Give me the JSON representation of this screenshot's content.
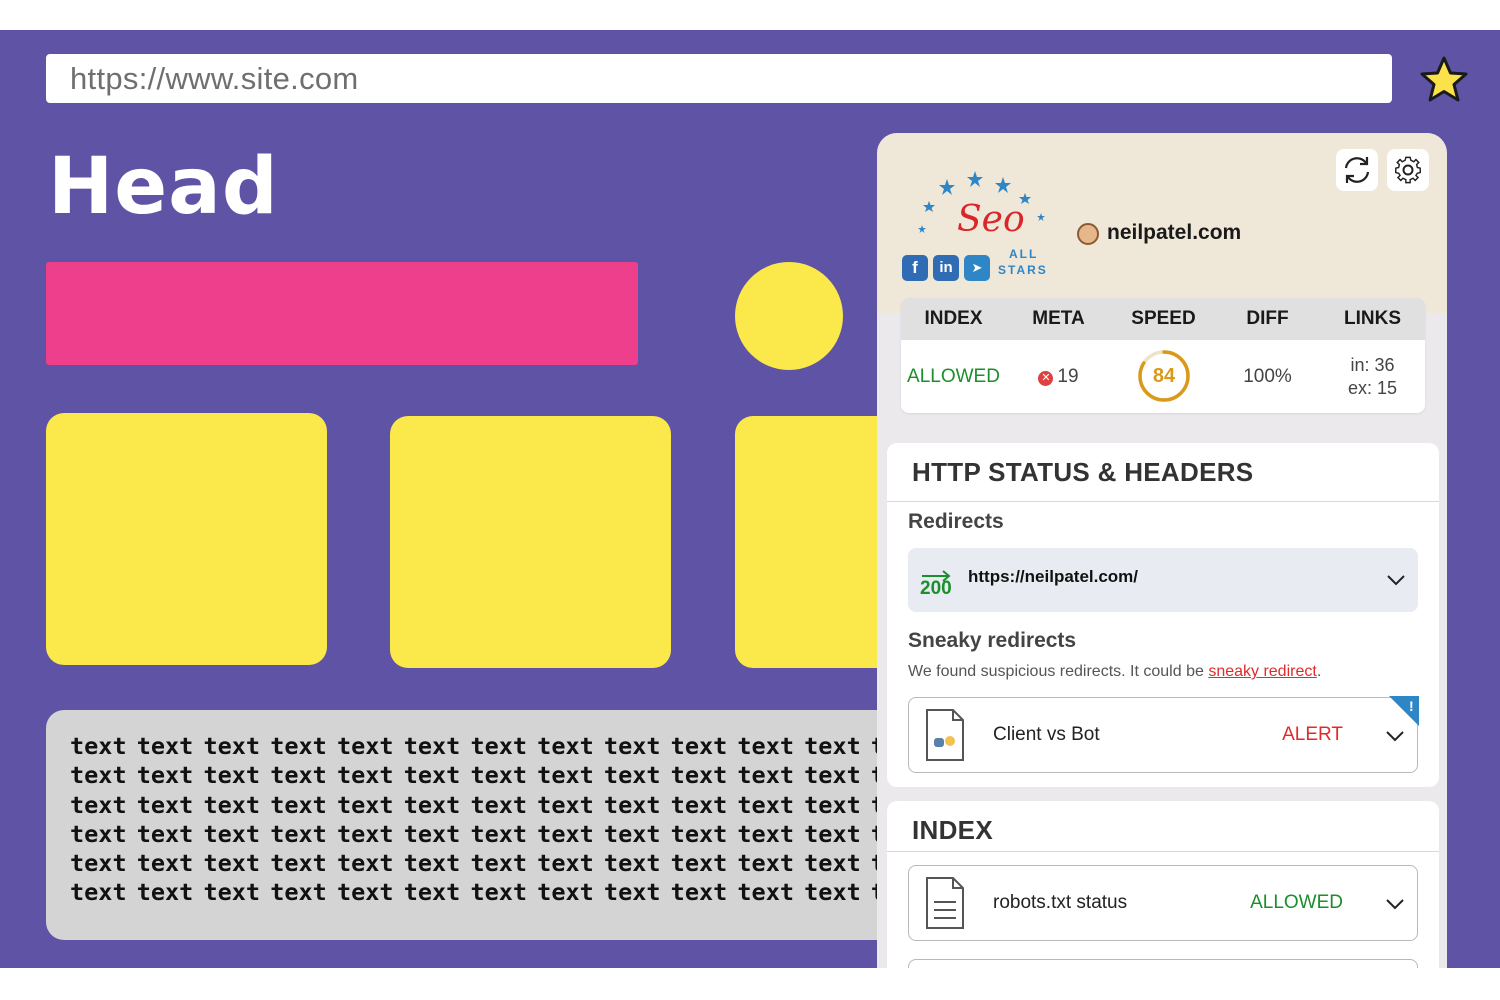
{
  "browser": {
    "url": "https://www.site.com",
    "bookmark_icon": "star-icon",
    "bookmark_color": "#fbe14a"
  },
  "page": {
    "head": "Head",
    "text_lines": [
      "text text text text text text text text text text text text text te",
      "text text text text text text text text text text text text text te",
      "text text text text text text text text text text text text text te",
      "text text text text text text text text text text text text text te",
      "text text text text text text text text text text text text text te",
      "text text text text text text text text text text text text text te"
    ],
    "colors": {
      "background": "#5e53a4",
      "pink": "#ee3f8d",
      "yellow": "#fbe84a",
      "text_block": "#d4d4d4"
    }
  },
  "extension": {
    "logo": {
      "word": "Seo",
      "all": "ALL",
      "stars": "STARS"
    },
    "social": [
      "f",
      "in",
      "➤"
    ],
    "site": "neilpatel.com",
    "stats": {
      "headers": [
        "INDEX",
        "META",
        "SPEED",
        "DIFF",
        "LINKS"
      ],
      "index_value": "ALLOWED",
      "meta_icon": "✕",
      "meta_value": "19",
      "speed_value": "84",
      "speed_score": 84,
      "diff_value": "100%",
      "links_in": "in: 36",
      "links_ex": "ex: 15"
    },
    "http": {
      "title": "HTTP STATUS & HEADERS",
      "redirects_title": "Redirects",
      "redirect_code": "200",
      "redirect_url": "https://neilpatel.com/",
      "sneaky_title": "Sneaky redirects",
      "sneaky_text": "We found suspicious redirects. It could be ",
      "sneaky_link": "sneaky redirect",
      "sneaky_end": ".",
      "client_label": "Client vs Bot",
      "client_status": "ALERT",
      "alert_flag": "!"
    },
    "index": {
      "title": "INDEX",
      "robots_label": "robots.txt status",
      "robots_status": "ALLOWED"
    },
    "colors": {
      "green": "#1c8f2c",
      "red": "#e02b2b",
      "amber": "#d99a1a",
      "blue": "#2f6cb3"
    }
  }
}
